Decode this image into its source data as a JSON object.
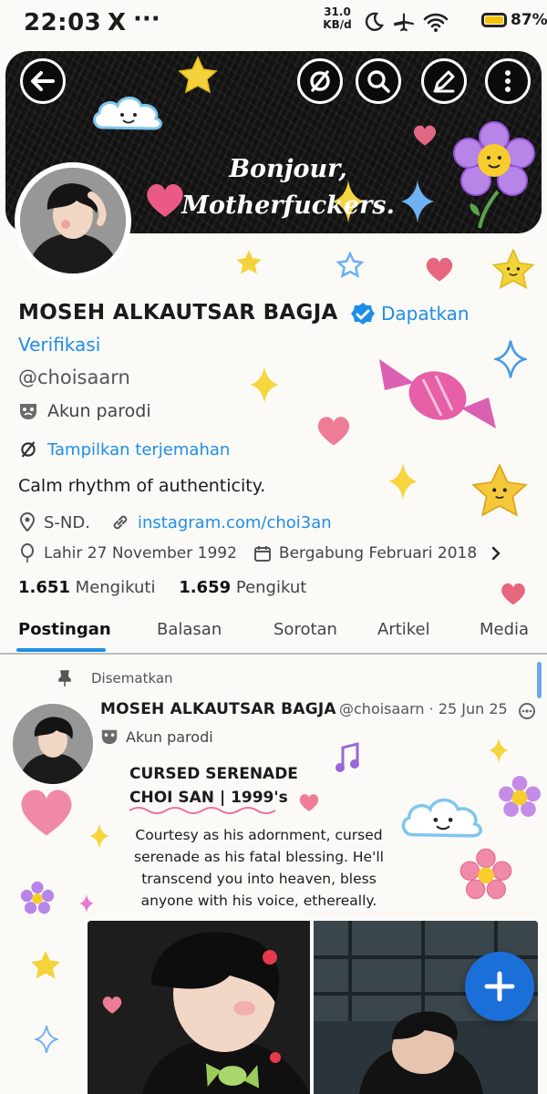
{
  "status_bar": {
    "time": "22:03",
    "x_icon": "x-logo-icon",
    "more_glyph": "···",
    "speed_value": "31.0",
    "speed_unit": "KB/d",
    "battery_percent": "87%",
    "battery_level": 0.87
  },
  "header": {
    "banner_text_line1": "Bonjour,",
    "banner_text_line2": "Motherfuckers.",
    "back_icon": "arrow-left-icon",
    "translate_icon": "no-translate-icon",
    "search_icon": "search-icon",
    "edit_icon": "edit-icon",
    "more_icon": "more-vertical-icon"
  },
  "profile": {
    "name": "MOSEH ALKAUTSAR BAGJA",
    "get_verified_line1": "Dapatkan",
    "get_verified_line2": "Verifikasi",
    "handle": "@choisaarn",
    "parody_label": "Akun parodi",
    "translate_label": "Tampilkan terjemahan",
    "bio": "Calm rhythm of authenticity.",
    "location": "S-ND.",
    "link": "instagram.com/choi3an",
    "birth": "Lahir 27 November 1992",
    "joined": "Bergabung Februari 2018",
    "following_count": "1.651",
    "following_label": "Mengikuti",
    "followers_count": "1.659",
    "followers_label": "Pengikut"
  },
  "tabs": [
    {
      "label": "Postingan",
      "active": true
    },
    {
      "label": "Balasan",
      "active": false
    },
    {
      "label": "Sorotan",
      "active": false
    },
    {
      "label": "Artikel",
      "active": false
    },
    {
      "label": "Media",
      "active": false
    }
  ],
  "post": {
    "pinned_label": "Disematkan",
    "author_name": "MOSEH ALKAUTSAR BAGJA",
    "author_handle_date": "@choisaarn · 25 Jun 25",
    "author_parody": "Akun parodi",
    "title_line1": "CURSED SERENADE",
    "title_line2": "CHOI SAN | 1999's",
    "body": "Courtesy as his adornment, cursed serenade as his fatal blessing. He'll transcend you into heaven, bless anyone with his voice, ethereally."
  },
  "colors": {
    "accent": "#1d8ee8",
    "fab": "#1b6fd9",
    "banner": "#121212",
    "background": "#fbfaf6"
  }
}
